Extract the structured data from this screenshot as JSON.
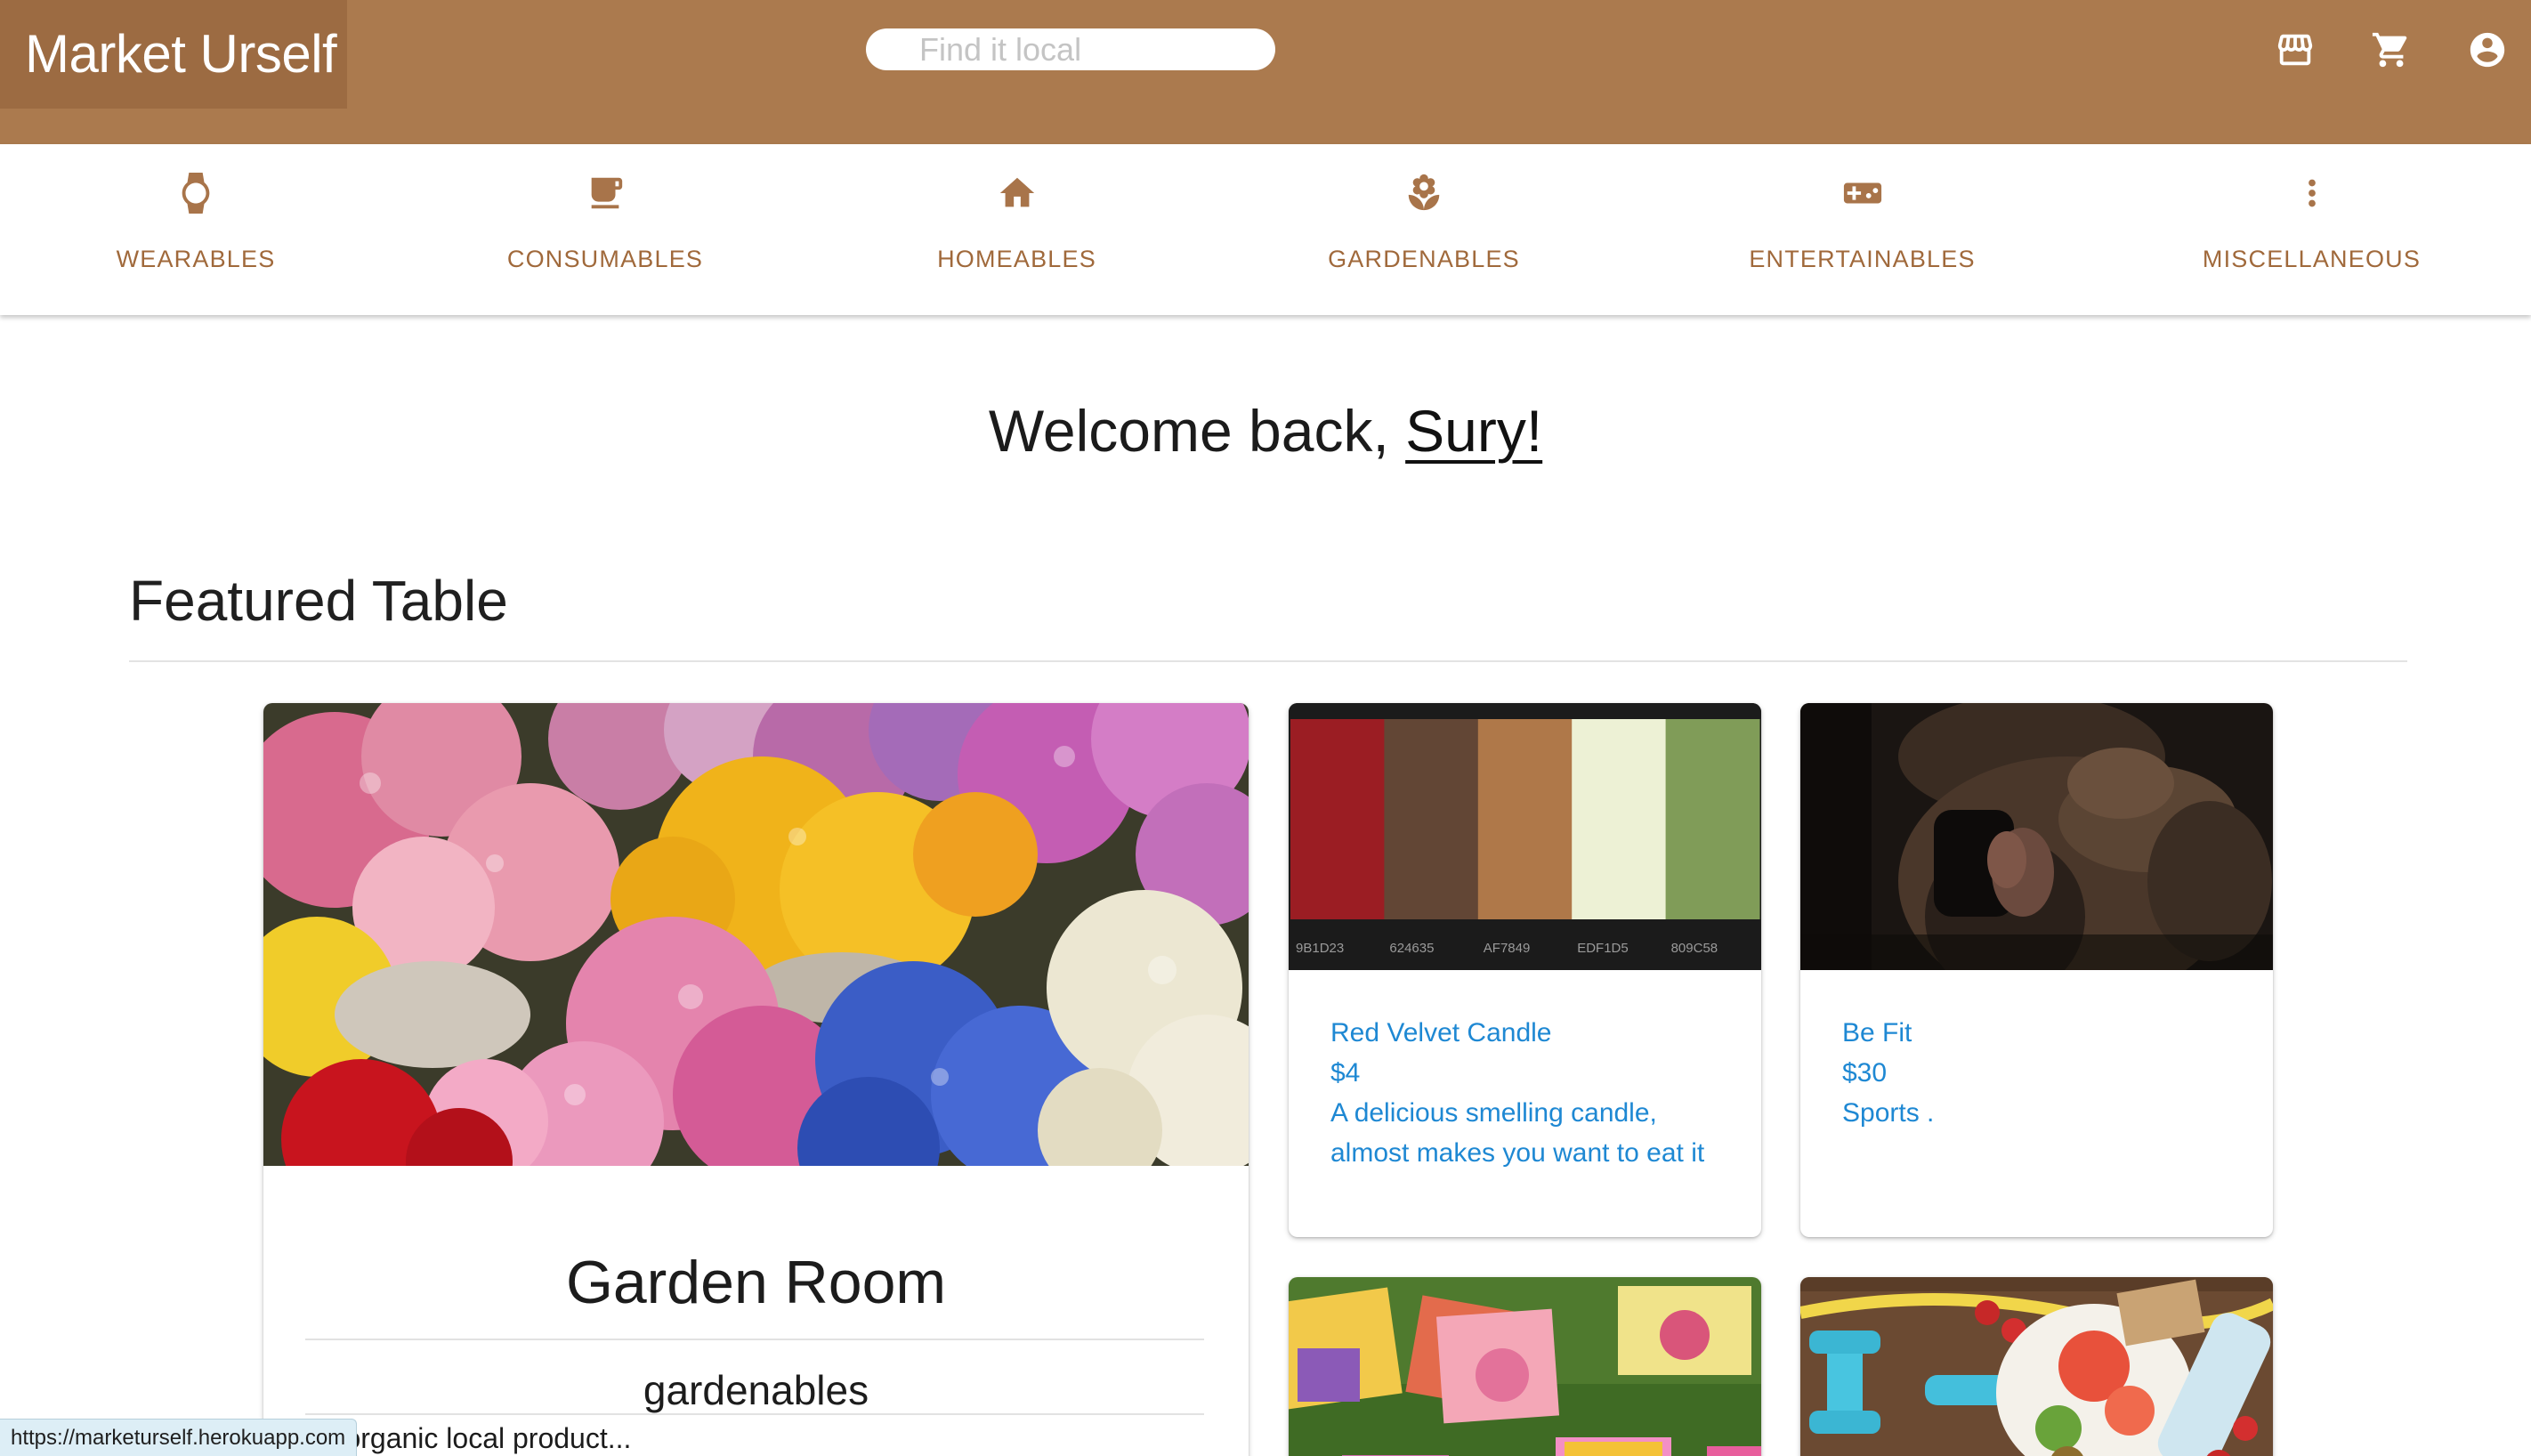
{
  "app": {
    "brand": "Market Urself",
    "search_placeholder": "Find it local"
  },
  "header_icons": [
    "store-icon",
    "cart-icon",
    "account-icon"
  ],
  "categories": [
    {
      "label": "WEARABLES",
      "icon": "watch-icon"
    },
    {
      "label": "CONSUMABLES",
      "icon": "coffee-icon"
    },
    {
      "label": "HOMEABLES",
      "icon": "home-icon"
    },
    {
      "label": "GARDENABLES",
      "icon": "flower-icon"
    },
    {
      "label": "ENTERTAINABLES",
      "icon": "gamepad-icon"
    },
    {
      "label": "MISCELLANEOUS",
      "icon": "more-vert-icon"
    }
  ],
  "welcome": {
    "prefix": "Welcome back, ",
    "username": "Sury!"
  },
  "featured": {
    "title": "Featured Table",
    "main_card": {
      "title": "Garden Room",
      "category": "gardenables",
      "description": "All organic local product..."
    },
    "cards": [
      {
        "name": "Red Velvet Candle",
        "price": "$4",
        "desc_line1": "A delicious smelling candle,",
        "desc_line2": "almost makes you want to eat it",
        "palette": [
          "#9B1D23",
          "#624635",
          "#AF7849",
          "#EDF1D5",
          "#809C58"
        ],
        "palette_codes": [
          "9B1D23",
          "624635",
          "AF7849",
          "EDF1D5",
          "809C58"
        ]
      },
      {
        "name": "Be Fit",
        "price": "$30",
        "category": "Sports ."
      }
    ]
  },
  "colors": {
    "header": "#ab7a4e",
    "brand_bg": "#9c6b42",
    "nav_accent": "#a0693b",
    "link": "#1e88d3"
  },
  "status_url": "https://marketurself.herokuapp.com"
}
